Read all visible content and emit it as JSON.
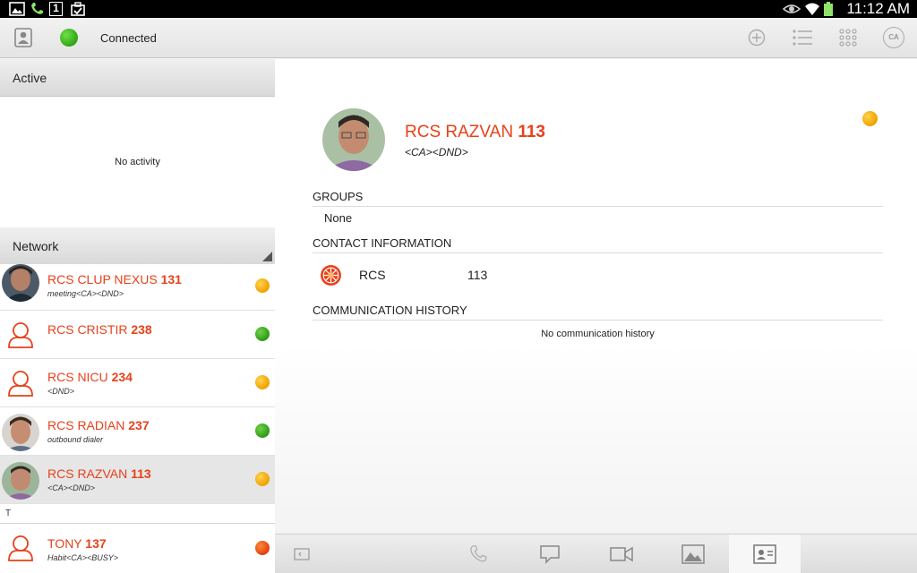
{
  "status_bar": {
    "time": "11:12 AM",
    "notification_count": "1"
  },
  "app_bar": {
    "connection_label": "Connected",
    "ca_label": "CA"
  },
  "active": {
    "header": "Active",
    "empty_text": "No activity"
  },
  "network": {
    "header": "Network",
    "contacts": [
      {
        "name": "RCS CLUP NEXUS",
        "number": "131",
        "status": "meeting<CA><DND>",
        "presence": "yellow",
        "avatar": "photo"
      },
      {
        "name": "RCS CRISTIR",
        "number": "238",
        "status": "",
        "presence": "green",
        "avatar": "placeholder"
      },
      {
        "name": "RCS NICU",
        "number": "234",
        "status": "<DND>",
        "presence": "yellow",
        "avatar": "placeholder"
      },
      {
        "name": "RCS RADIAN",
        "number": "237",
        "status": "outbound dialer",
        "presence": "green",
        "avatar": "photo"
      },
      {
        "name": "RCS RAZVAN",
        "number": "113",
        "status": "<CA><DND>",
        "presence": "yellow",
        "avatar": "photo",
        "selected": true
      },
      {
        "name": "TONY",
        "number": "137",
        "status": "Habit<CA><BUSY>",
        "presence": "red",
        "avatar": "placeholder"
      }
    ],
    "letter_header": "T"
  },
  "detail": {
    "name": "RCS RAZVAN",
    "number": "113",
    "status": "<CA><DND>",
    "groups_header": "GROUPS",
    "groups_value": "None",
    "contact_info_header": "CONTACT INFORMATION",
    "contact_info_type": "RCS",
    "contact_info_value": "113",
    "history_header": "COMMUNICATION HISTORY",
    "history_empty": "No communication history"
  },
  "colors": {
    "accent": "#e8411a",
    "presence_green": "#3aa51b",
    "presence_yellow": "#f5b000",
    "presence_red": "#e8501a"
  },
  "bottom_bar": {
    "buttons": [
      "collapse-icon",
      "phone-icon",
      "chat-icon",
      "video-icon",
      "image-icon",
      "contact-card-icon"
    ],
    "active": "contact-card-icon"
  }
}
